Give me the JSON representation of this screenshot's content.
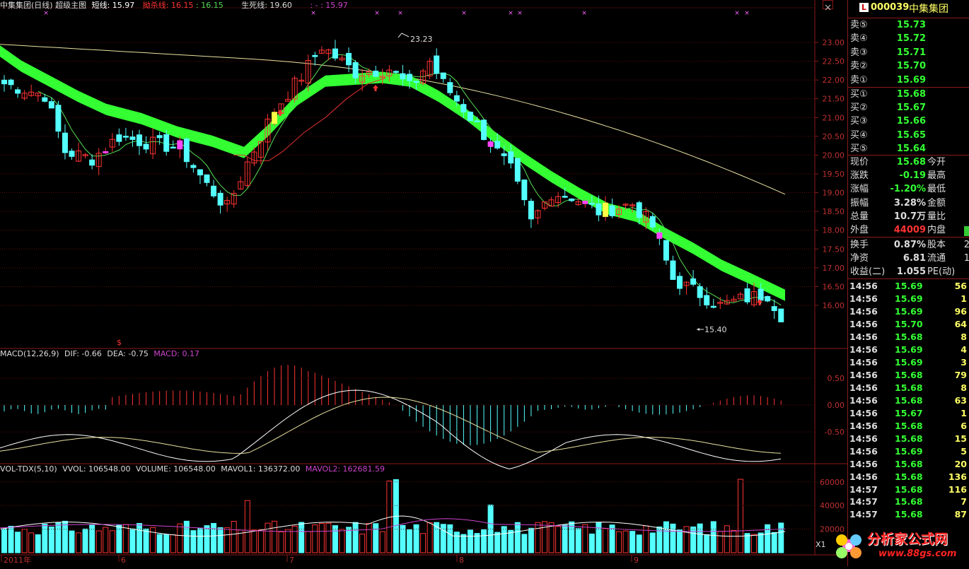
{
  "header": {
    "title": "中集集团(日线) 超级主图",
    "short_label": "短线: 15.97",
    "kill_label": "拗杀线: 16.15",
    "kill_val2": ": 16.15",
    "life_label": "生死线: 19.60",
    "extra_label": ": - : 15.97"
  },
  "price_axis": [
    "23.00",
    "22.50",
    "22.00",
    "21.50",
    "21.00",
    "20.50",
    "20.00",
    "19.50",
    "19.00",
    "18.50",
    "18.00",
    "17.50",
    "17.00",
    "16.50",
    "16.00"
  ],
  "annotations": {
    "high": "23.23",
    "low": "15.40",
    "dollar": "$"
  },
  "macd": {
    "title": "MACD(12,26,9)",
    "dif": "DIF: -0.66",
    "dea": "DEA: -0.75",
    "macd": "MACD: 0.17",
    "axis": [
      "0.50",
      "0.00",
      "-0.50"
    ]
  },
  "vol": {
    "title": "VOL-TDX(5,10)",
    "vvol": "VVOL: 106548.00",
    "volume": "VOLUME: 106548.00",
    "mavol1": "MAVOL1: 136372.00",
    "mavol2": "MAVOL2: 162681.59",
    "axis": [
      "60000",
      "40000",
      "20000"
    ],
    "xunit": "X1"
  },
  "xaxis": [
    "2011年",
    "6",
    "7",
    "8",
    "9"
  ],
  "colors": {
    "up": "#ff3333",
    "down": "#54ffff",
    "ribbon": "#33ff33",
    "ma_long": "#e8e0a0",
    "ma_red": "#e03030",
    "ma_green": "#55dd55",
    "frame": "#8b1a1a"
  },
  "quote": {
    "code": "000039",
    "name": "中集集团",
    "sell": [
      {
        "label": "卖⑤",
        "price": "15.73"
      },
      {
        "label": "卖④",
        "price": "15.72"
      },
      {
        "label": "卖③",
        "price": "15.71"
      },
      {
        "label": "卖②",
        "price": "15.70"
      },
      {
        "label": "卖①",
        "price": "15.69"
      }
    ],
    "buy": [
      {
        "label": "买①",
        "price": "15.68"
      },
      {
        "label": "买②",
        "price": "15.67"
      },
      {
        "label": "买③",
        "price": "15.66"
      },
      {
        "label": "买④",
        "price": "15.65"
      },
      {
        "label": "买⑤",
        "price": "15.64"
      }
    ],
    "stats": [
      {
        "l": "现价",
        "v": "15.68",
        "l2": "今开",
        "v2": ""
      },
      {
        "l": "涨跌",
        "v": "-0.19",
        "l2": "最高",
        "v2": ""
      },
      {
        "l": "涨幅",
        "v": "-1.20%",
        "l2": "最低",
        "v2": ""
      },
      {
        "l": "振幅",
        "v": "3.28%",
        "l2": "金额",
        "v2": ""
      },
      {
        "l": "总量",
        "v": "10.7万",
        "l2": "量比",
        "v2": ""
      },
      {
        "l": "外盘",
        "v": "44009",
        "l2": "内盘",
        "v2": ""
      }
    ],
    "stats2": [
      {
        "l": "换手",
        "v": "0.87%",
        "l2": "股本",
        "v2": "2"
      },
      {
        "l": "净资",
        "v": "6.81",
        "l2": "流通",
        "v2": "1"
      },
      {
        "l": "收益(二)",
        "v": "1.055",
        "l2": "PE(动)",
        "v2": ""
      }
    ],
    "ticks": [
      {
        "t": "14:56",
        "p": "15.69",
        "v": "56"
      },
      {
        "t": "14:56",
        "p": "15.69",
        "v": "1"
      },
      {
        "t": "14:56",
        "p": "15.69",
        "v": "96"
      },
      {
        "t": "14:56",
        "p": "15.70",
        "v": "64"
      },
      {
        "t": "14:56",
        "p": "15.68",
        "v": "8"
      },
      {
        "t": "14:56",
        "p": "15.69",
        "v": "4"
      },
      {
        "t": "14:56",
        "p": "15.69",
        "v": "3"
      },
      {
        "t": "14:56",
        "p": "15.68",
        "v": "79"
      },
      {
        "t": "14:56",
        "p": "15.68",
        "v": "8"
      },
      {
        "t": "14:56",
        "p": "15.68",
        "v": "63"
      },
      {
        "t": "14:56",
        "p": "15.67",
        "v": "1"
      },
      {
        "t": "14:56",
        "p": "15.68",
        "v": "6"
      },
      {
        "t": "14:56",
        "p": "15.68",
        "v": "15"
      },
      {
        "t": "14:56",
        "p": "15.69",
        "v": "5"
      },
      {
        "t": "14:56",
        "p": "15.68",
        "v": "20"
      },
      {
        "t": "14:56",
        "p": "15.68",
        "v": "136"
      },
      {
        "t": "14:57",
        "p": "15.68",
        "v": "116"
      },
      {
        "t": "14:57",
        "p": "15.68",
        "v": "7"
      },
      {
        "t": "14:57",
        "p": "15.68",
        "v": "87"
      }
    ]
  },
  "watermark": {
    "text": "分析家公式网",
    "url": "www.88gs.com"
  }
}
